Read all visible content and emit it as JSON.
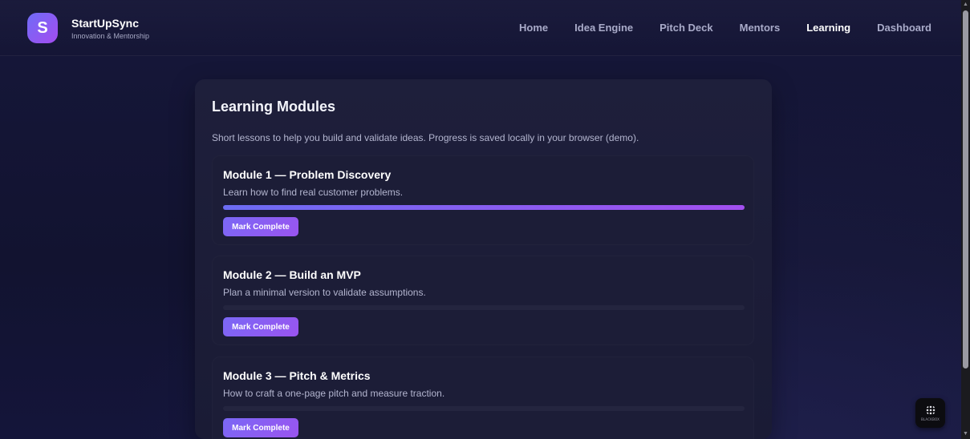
{
  "brand": {
    "logo_letter": "S",
    "name": "StartUpSync",
    "tagline": "Innovation & Mentorship"
  },
  "nav": {
    "items": [
      {
        "label": "Home",
        "active": false
      },
      {
        "label": "Idea Engine",
        "active": false
      },
      {
        "label": "Pitch Deck",
        "active": false
      },
      {
        "label": "Mentors",
        "active": false
      },
      {
        "label": "Learning",
        "active": true
      },
      {
        "label": "Dashboard",
        "active": false
      }
    ]
  },
  "main": {
    "title": "Learning Modules",
    "intro": "Short lessons to help you build and validate ideas. Progress is saved locally in your browser (demo).",
    "modules": [
      {
        "title": "Module 1 — Problem Discovery",
        "description": "Learn how to find real customer problems.",
        "progress": 1.0,
        "button_label": "Mark Complete"
      },
      {
        "title": "Module 2 — Build an MVP",
        "description": "Plan a minimal version to validate assumptions.",
        "progress": 0,
        "button_label": "Mark Complete"
      },
      {
        "title": "Module 3 — Pitch & Metrics",
        "description": "How to craft a one-page pitch and measure traction.",
        "progress": 0,
        "button_label": "Mark Complete"
      }
    ]
  },
  "widget": {
    "label": "BLACKBOX",
    "icon": "dot-grid-icon"
  },
  "colors": {
    "accent_start": "#6c6cf2",
    "accent_end": "#a24ff0",
    "background": "#13142b",
    "card": "#1e1f3b"
  }
}
